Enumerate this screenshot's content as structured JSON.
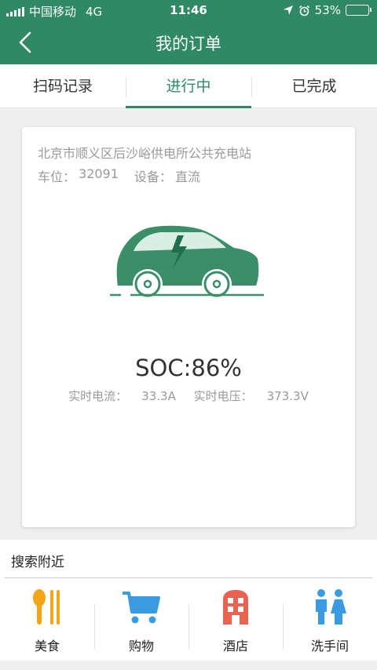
{
  "status_bar": {
    "carrier": "中国移动",
    "network": "4G",
    "time": "11:46",
    "battery": "53%",
    "battery_level": 0.53
  },
  "nav": {
    "title": "我的订单"
  },
  "tabs": [
    {
      "label": "扫码记录",
      "active": false
    },
    {
      "label": "进行中",
      "active": true
    },
    {
      "label": "已完成",
      "active": false
    }
  ],
  "order": {
    "station": "北京市顺义区后沙峪供电所公共充电站",
    "slot_label": "车位：",
    "slot": "32091",
    "device_label": "设备：",
    "device": "直流",
    "soc": "SOC:86%",
    "current_label": "实时电流：",
    "current": "33.3A",
    "voltage_label": "实时电压：",
    "voltage": "373.3V"
  },
  "nearby": {
    "title": "搜索附近",
    "items": [
      {
        "label": "美食",
        "icon": "food-icon",
        "color": "#f2a516"
      },
      {
        "label": "购物",
        "icon": "cart-icon",
        "color": "#3a9be0"
      },
      {
        "label": "酒店",
        "icon": "hotel-icon",
        "color": "#e86450"
      },
      {
        "label": "洗手间",
        "icon": "restroom-icon",
        "color": "#3a9be0"
      }
    ]
  },
  "colors": {
    "brand": "#2f8a63",
    "background": "#efefef"
  }
}
